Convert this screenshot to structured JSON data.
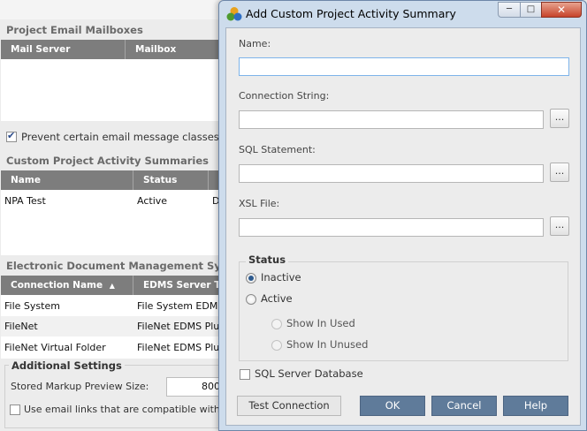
{
  "background": {
    "email_section": {
      "title": "Project Email Mailboxes",
      "columns": [
        "Mail Server",
        "Mailbox"
      ]
    },
    "prevent_checkbox": {
      "label": "Prevent certain email message classes",
      "checked": true
    },
    "activity_section": {
      "title": "Custom Project Activity Summaries",
      "columns": [
        "Name",
        "Status",
        ""
      ],
      "rows": [
        {
          "name": "NPA Test",
          "status": "Active",
          "extra": "D"
        }
      ]
    },
    "edms_section": {
      "title": "Electronic Document Management Sys",
      "columns": [
        "Connection Name",
        "EDMS Server T"
      ],
      "sort_icon": "sort-up-triangle",
      "rows": [
        {
          "name": "File System",
          "type": "File System EDM"
        },
        {
          "name": "FileNet",
          "type": "FileNet EDMS Plu"
        },
        {
          "name": "FileNet Virtual Folder",
          "type": "FileNet EDMS Plu"
        }
      ]
    },
    "additional": {
      "title": "Additional Settings",
      "markup_label": "Stored Markup Preview Size:",
      "markup_value": "800",
      "email_links_label": "Use email links that are compatible with",
      "email_links_checked": false
    }
  },
  "dialog": {
    "title": "Add Custom Project Activity Summary",
    "title_icon": "colored-circles-icon",
    "window_buttons": {
      "minimize": "─",
      "maximize": "□",
      "close": "✕"
    },
    "name_label": "Name:",
    "name_value": "",
    "connection_label": "Connection String:",
    "connection_value": "",
    "sql_label": "SQL Statement:",
    "sql_value": "",
    "xsl_label": "XSL File:",
    "xsl_value": "",
    "browse_label": "...",
    "status_title": "Status",
    "status_options": {
      "inactive": "Inactive",
      "active": "Active"
    },
    "status_selected": "Inactive",
    "sub_options": {
      "used": "Show In Used",
      "unused": "Show In Unused"
    },
    "sql_server_label": "SQL Server Database",
    "sql_server_checked": false,
    "buttons": {
      "test": "Test Connection",
      "ok": "OK",
      "cancel": "Cancel",
      "help": "Help"
    }
  },
  "colors": {
    "dialog_frame": "#cddcec",
    "button_primary": "#5f7b9a",
    "grid_header": "#7d7d7d"
  }
}
